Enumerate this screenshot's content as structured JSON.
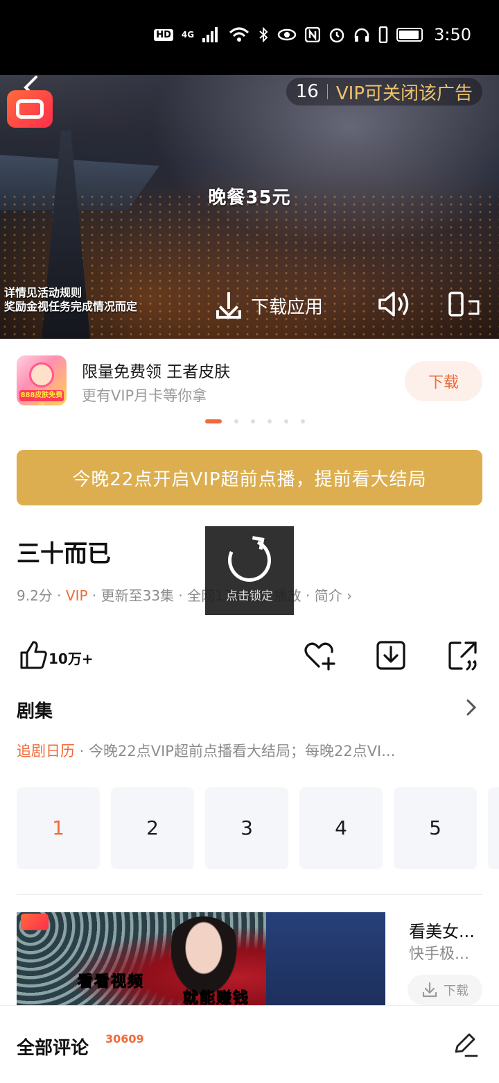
{
  "status_bar": {
    "time": "3:50",
    "hd": "HD",
    "network": "4G"
  },
  "ad_video": {
    "countdown": "16",
    "vip_close": "VIP可关闭该广告",
    "center_caption": "晚餐35元",
    "rules_line1": "详情见活动规则",
    "rules_line2": "奖励金视任务完成情况而定",
    "download_label": "下载应用"
  },
  "promo": {
    "title": "限量免费领 王者皮肤",
    "subtitle": "更有VIP月卡等你拿",
    "button": "下载",
    "icon_tag": "888皮肤免费送"
  },
  "banner": {
    "text": "今晚22点开启VIP超前点播，提前看大结局"
  },
  "show": {
    "title": "三十而已",
    "score": "9.2分",
    "vip": "VIP",
    "meta_rest": "· 更新至33集 · 全网17.0亿次播放 · 简介 ›"
  },
  "lock_overlay": {
    "label": "点击锁定"
  },
  "actions": {
    "like_count": "10万+"
  },
  "episodes": {
    "header": "剧集",
    "calendar_label": "追剧日历",
    "calendar_text": " · 今晚22点VIP超前点播看大结局；每晚22点VI...",
    "items": [
      "1",
      "2",
      "3",
      "4",
      "5"
    ],
    "current": "1"
  },
  "feed_ad": {
    "title": "看美女...",
    "source": "快手极...",
    "button": "下载",
    "caption_line1": "看看视频",
    "caption_line2": "就能赚钱"
  },
  "comments": {
    "label": "全部评论",
    "count": "30609"
  },
  "colors": {
    "accent": "#f06a3b",
    "gold_banner": "#dcae4f",
    "vip_gold": "#f0c36a"
  }
}
